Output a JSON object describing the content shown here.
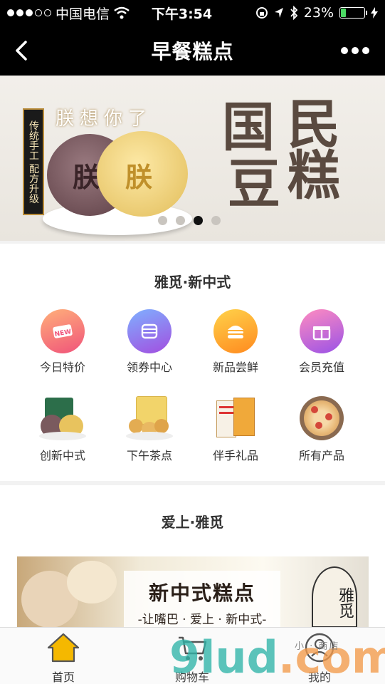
{
  "status_bar": {
    "carrier": "中国电信",
    "time": "下午3:54",
    "battery_percent": "23%",
    "battery_level": 0.23,
    "battery_color": "#4cd964"
  },
  "nav": {
    "title": "早餐糕点",
    "back_icon": "chevron-left-icon",
    "more_icon": "more-dots-icon"
  },
  "banner": {
    "side_text": "传统手工 配方升级",
    "tagline": "朕想你了",
    "cake_text_1": "朕",
    "cake_text_2": "朕",
    "big_1": "国",
    "big_2": "民",
    "big_3": "豆",
    "big_4": "糕",
    "slide_count": 4,
    "active_slide": 3
  },
  "section1": {
    "title": "雅觅·新中式",
    "row1": [
      {
        "label": "今日特价",
        "icon": "new-tag-icon",
        "color_from": "#ffb07a",
        "color_to": "#f0537a"
      },
      {
        "label": "领券中心",
        "icon": "wallet-icon",
        "color_from": "#7fb0ff",
        "color_to": "#a24ee0"
      },
      {
        "label": "新品尝鲜",
        "icon": "burger-icon",
        "color_from": "#ffd24a",
        "color_to": "#ff8a1f"
      },
      {
        "label": "会员充值",
        "icon": "gift-icon",
        "color_from": "#ff8cc0",
        "color_to": "#9a52e6"
      }
    ],
    "row2": [
      {
        "label": "创新中式",
        "icon": "mooncake-product-icon"
      },
      {
        "label": "下午茶点",
        "icon": "pastry-box-product-icon"
      },
      {
        "label": "伴手礼品",
        "icon": "gift-box-product-icon"
      },
      {
        "label": "所有产品",
        "icon": "cookie-plate-product-icon"
      }
    ]
  },
  "section2": {
    "title": "爱上·雅觅",
    "promo_title": "新中式糕点",
    "promo_sub": "-让嘴巴 · 爱上 · 新中式-",
    "promo_brand": "雅觅"
  },
  "tabbar": {
    "home": "首页",
    "cart": "购物车",
    "me": "我的",
    "home_icon": "home-icon",
    "cart_icon": "cart-icon",
    "me_icon": "user-icon",
    "active_color": "#f5b800"
  },
  "watermark": {
    "text": "9lud",
    "suffix": ".com",
    "small": "小 · 商店"
  }
}
